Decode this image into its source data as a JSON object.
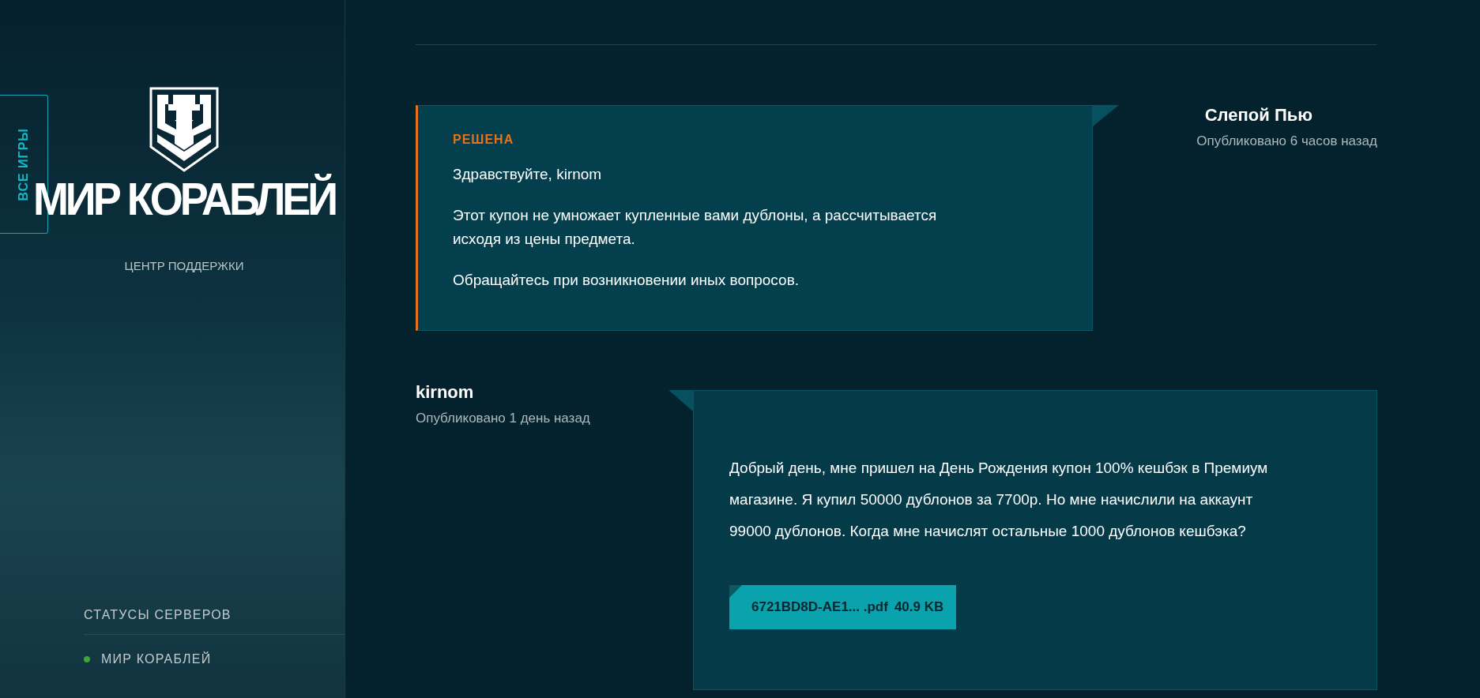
{
  "sidebar": {
    "all_games_tab": "ВСЕ ИГРЫ",
    "logo_text": "МИР КОРАБЛЕЙ",
    "subtitle": "ЦЕНТР ПОДДЕРЖКИ",
    "server_status": {
      "title": "СТАТУСЫ СЕРВЕРОВ",
      "servers": [
        {
          "name": "МИР КОРАБЛЕЙ",
          "color": "#3fa535"
        }
      ]
    }
  },
  "messages": [
    {
      "kind": "staff",
      "author": "Слепой Пью",
      "posted": "Опубликовано 6 часов назад",
      "status": "РЕШЕНА",
      "paragraphs": [
        "Здравствуйте, kirnom",
        "Этот купон не умножает купленные вами дублоны, а рассчитывается исходя из цены предмета.",
        "Обращайтесь при возникновении иных вопросов."
      ]
    },
    {
      "kind": "user",
      "author": "kirnom",
      "posted": "Опубликовано 1 день назад",
      "paragraphs": [
        "Добрый день, мне пришел на День Рождения купон 100% кешбэк в Премиум магазине. Я купил 50000 дублонов за 7700р. Но мне начислили на аккаунт 99000 дублонов. Когда мне начислят остальные 1000 дублонов кешбэка?"
      ],
      "attachments": [
        {
          "name": "6721BD8D-AE1... .pdf",
          "size": "40.9 KB"
        }
      ]
    }
  ]
}
